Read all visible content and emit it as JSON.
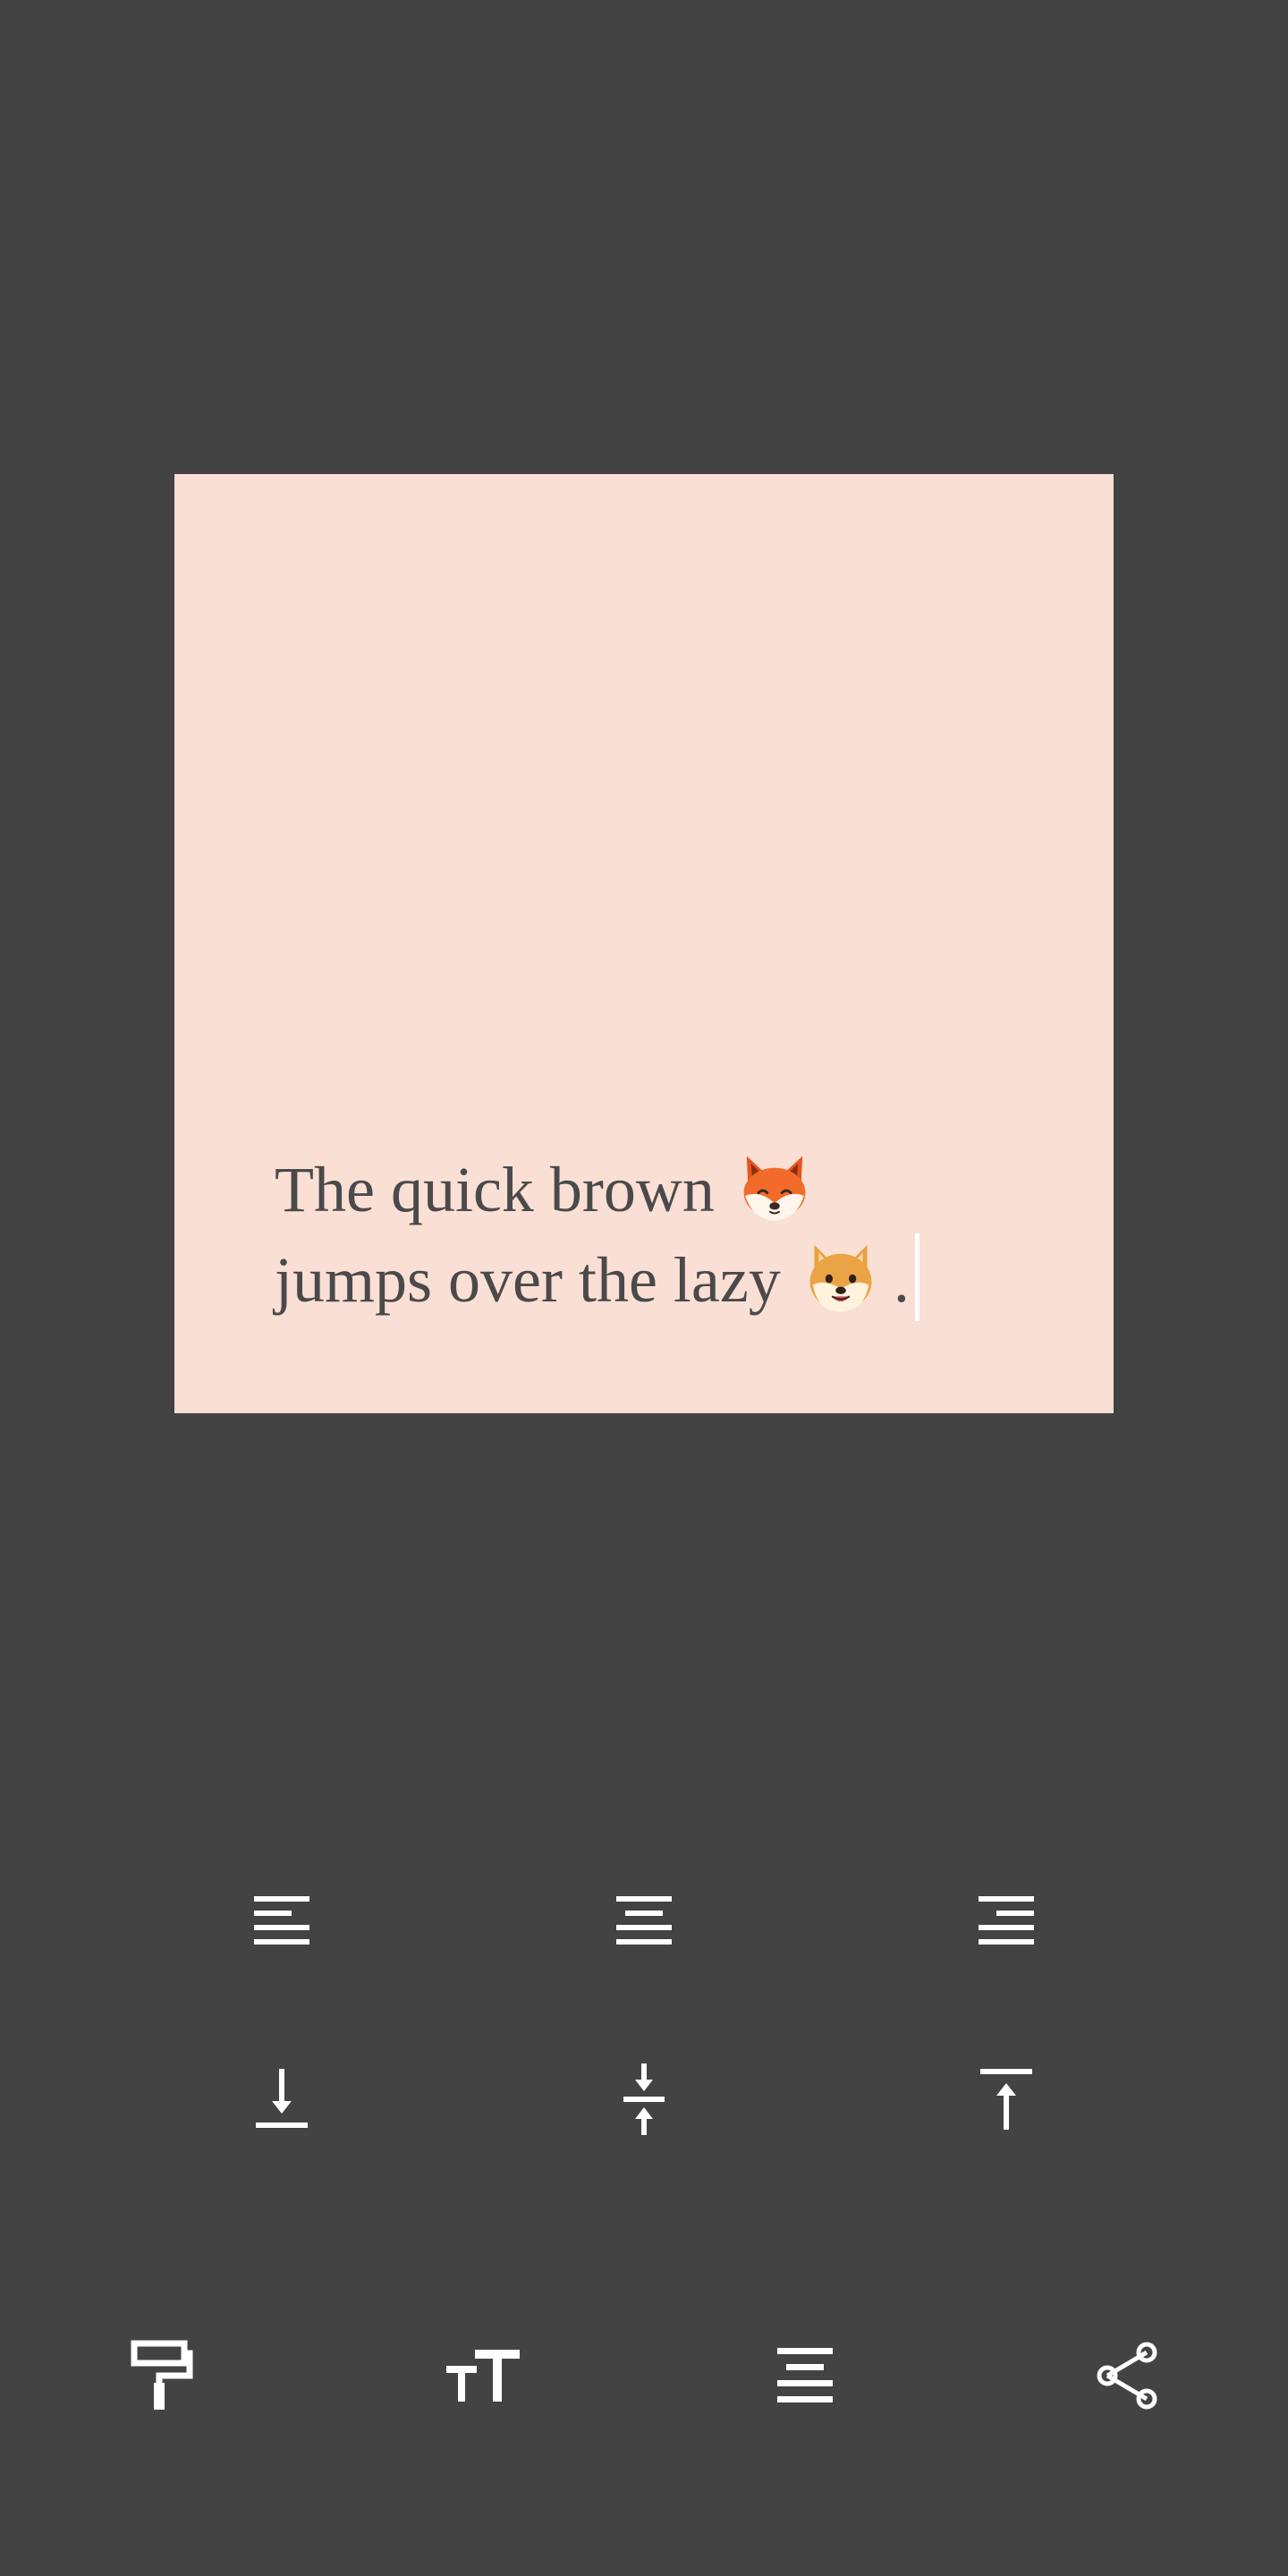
{
  "note": {
    "line1": "The quick brown",
    "line2": "jumps over the lazy",
    "line2_end": ".",
    "emoji1": "fox-face-emoji",
    "emoji2": "dog-face-emoji",
    "background_color": "#fadfd5",
    "text_color": "#4a4a4a"
  },
  "horizontal_alignment": {
    "options": [
      "align-left-icon",
      "align-center-icon",
      "align-right-icon"
    ]
  },
  "vertical_alignment": {
    "options": [
      "align-bottom-icon",
      "align-middle-icon",
      "align-top-icon"
    ]
  },
  "toolbar": {
    "items": [
      "paint-roller-icon",
      "text-size-icon",
      "align-justify-icon",
      "share-icon"
    ]
  },
  "colors": {
    "app_background": "#434343",
    "icon": "#ffffff"
  }
}
